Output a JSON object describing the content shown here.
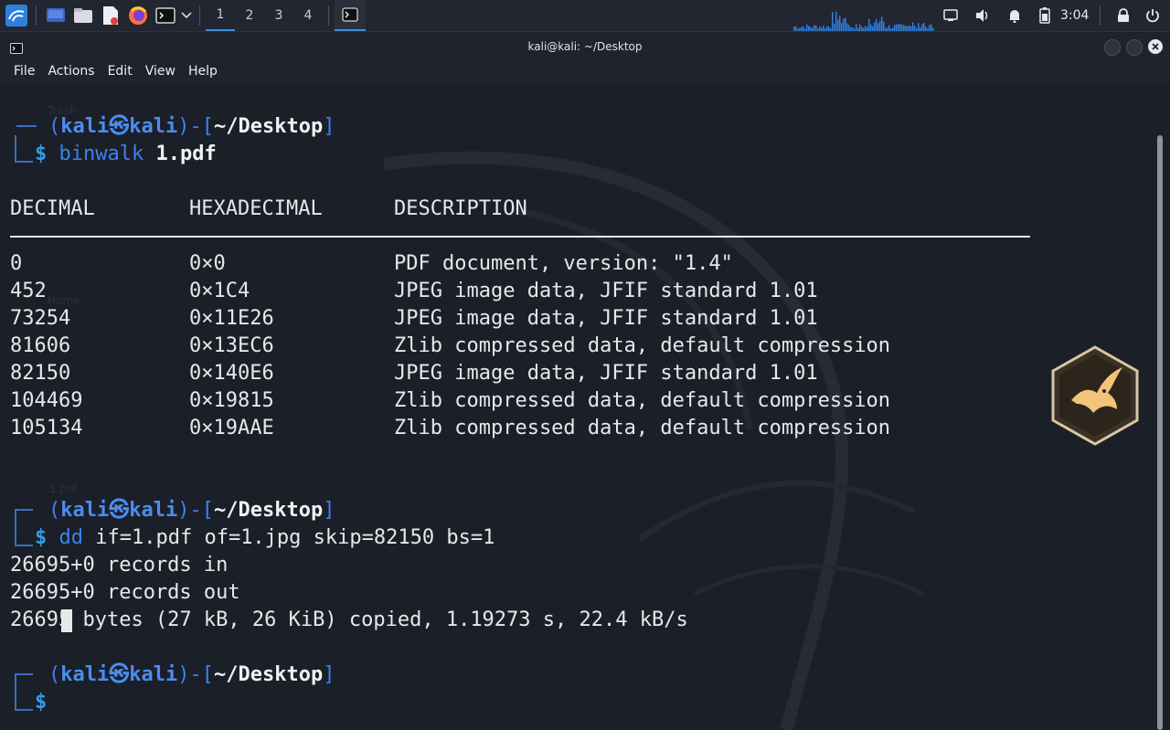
{
  "panel": {
    "workspaces": [
      "1",
      "2",
      "3",
      "4"
    ],
    "clock": "3:04",
    "icons": [
      "kali-menu-icon",
      "desktop-icon",
      "file-manager-icon",
      "text-editor-icon",
      "firefox-icon",
      "terminal-icon",
      "chevron-down-icon",
      "network-icon",
      "volume-icon",
      "notification-bell-icon",
      "battery-icon",
      "lock-icon",
      "power-icon"
    ]
  },
  "window": {
    "title": "kali@kali: ~/Desktop",
    "menu": [
      "File",
      "Actions",
      "Edit",
      "View",
      "Help"
    ]
  },
  "desktop_ghosts": [
    "Trash",
    "Home",
    "1.pdf"
  ],
  "terminal": {
    "prompt": {
      "open": "(",
      "user": "kali",
      "at": "㉿",
      "host": "kali",
      "close": ")",
      "dash": "-[",
      "path": "~/Desktop",
      "end": "]",
      "dollar": "$"
    },
    "cmd1": {
      "name": "binwalk",
      "arg": "1.pdf"
    },
    "header": {
      "decimal": "DECIMAL",
      "hex": "HEXADECIMAL",
      "desc": "DESCRIPTION"
    },
    "rows": [
      {
        "decimal": "0",
        "hex": "0×0",
        "desc": "PDF document, version: \"1.4\""
      },
      {
        "decimal": "452",
        "hex": "0×1C4",
        "desc": "JPEG image data, JFIF standard 1.01"
      },
      {
        "decimal": "73254",
        "hex": "0×11E26",
        "desc": "JPEG image data, JFIF standard 1.01"
      },
      {
        "decimal": "81606",
        "hex": "0×13EC6",
        "desc": "Zlib compressed data, default compression"
      },
      {
        "decimal": "82150",
        "hex": "0×140E6",
        "desc": "JPEG image data, JFIF standard 1.01"
      },
      {
        "decimal": "104469",
        "hex": "0×19815",
        "desc": "Zlib compressed data, default compression"
      },
      {
        "decimal": "105134",
        "hex": "0×19AAE",
        "desc": "Zlib compressed data, default compression"
      }
    ],
    "cmd2": {
      "name": "dd",
      "args": "if=1.pdf of=1.jpg skip=82150 bs=1"
    },
    "dd_out": [
      "26695+0 records in",
      "26695+0 records out",
      "26695 bytes (27 kB, 26 KiB) copied, 1.19273 s, 22.4 kB/s"
    ]
  },
  "colors": {
    "accent": "#3b8fe8",
    "prompt_blue": "#4b8df0",
    "background": "#1b1f28"
  }
}
